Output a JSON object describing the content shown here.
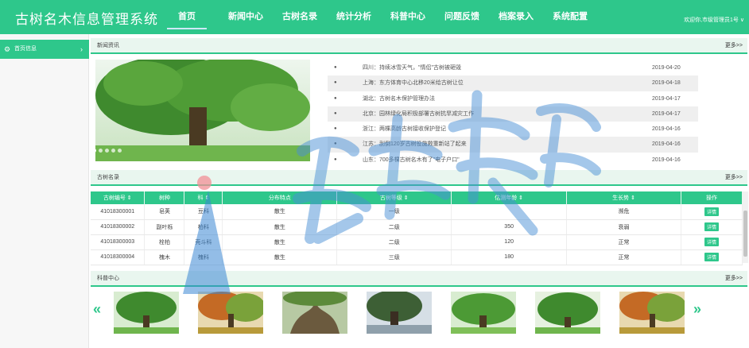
{
  "app": {
    "title": "古树名木信息管理系统",
    "welcome": "欢迎你,市级管理员1号 ∨"
  },
  "nav": [
    {
      "label": "首页"
    },
    {
      "label": "新闻中心"
    },
    {
      "label": "古树名录"
    },
    {
      "label": "统计分析"
    },
    {
      "label": "科普中心"
    },
    {
      "label": "问题反馈"
    },
    {
      "label": "档案录入"
    },
    {
      "label": "系统配置"
    }
  ],
  "sidebar": {
    "item_label": "首页信息"
  },
  "news_panel": {
    "title": "新闻资讯",
    "more": "更多>>",
    "items": [
      {
        "text": "四川：持续冰雪天气，\"情侣\"古树被砸毁",
        "date": "2019-04-20"
      },
      {
        "text": "上海：东方体育中心北移20米给古树让位",
        "date": "2019-04-18"
      },
      {
        "text": "湖北：古树名木保护管理办法",
        "date": "2019-04-17"
      },
      {
        "text": "北京：园林绿化局积极部署古树抗旱减灾工作",
        "date": "2019-04-17"
      },
      {
        "text": "浙江：两棵高龄古树接收保护登记",
        "date": "2019-04-16"
      },
      {
        "text": "江苏：刮倒120岁古树役施救重新站了起来",
        "date": "2019-04-16"
      },
      {
        "text": "山东：700多棵古树名木有了\"电子户口\"",
        "date": "2019-04-16"
      }
    ]
  },
  "tree_panel": {
    "title": "古树名录",
    "more": "更多>>",
    "columns": [
      "古树编号 ⇕",
      "树种",
      "科 ⇕",
      "分布特点",
      "古树等级 ⇕",
      "估测年龄 ⇕",
      "生长势 ⇕",
      "操作"
    ],
    "rows": [
      {
        "id": "41018300001",
        "species": "皂荚",
        "family": "豆科",
        "dist": "散生",
        "level": "一级",
        "age": "",
        "growth": "濒危",
        "action": "详情"
      },
      {
        "id": "41018300002",
        "species": "副叶栎",
        "family": "柏科",
        "dist": "散生",
        "level": "二级",
        "age": "350",
        "growth": "衰弱",
        "action": "详情"
      },
      {
        "id": "41018300003",
        "species": "栓柏",
        "family": "壳斗科",
        "dist": "散生",
        "level": "二级",
        "age": "120",
        "growth": "正常",
        "action": "详情"
      },
      {
        "id": "41018300004",
        "species": "槐木",
        "family": "槐科",
        "dist": "散生",
        "level": "三级",
        "age": "180",
        "growth": "正常",
        "action": "详情"
      }
    ]
  },
  "science_panel": {
    "title": "科普中心",
    "more": "更多>>",
    "prev": "«",
    "next": "»"
  },
  "colors": {
    "accent": "#2ec78b",
    "panel_bg": "#e9f6ef"
  }
}
